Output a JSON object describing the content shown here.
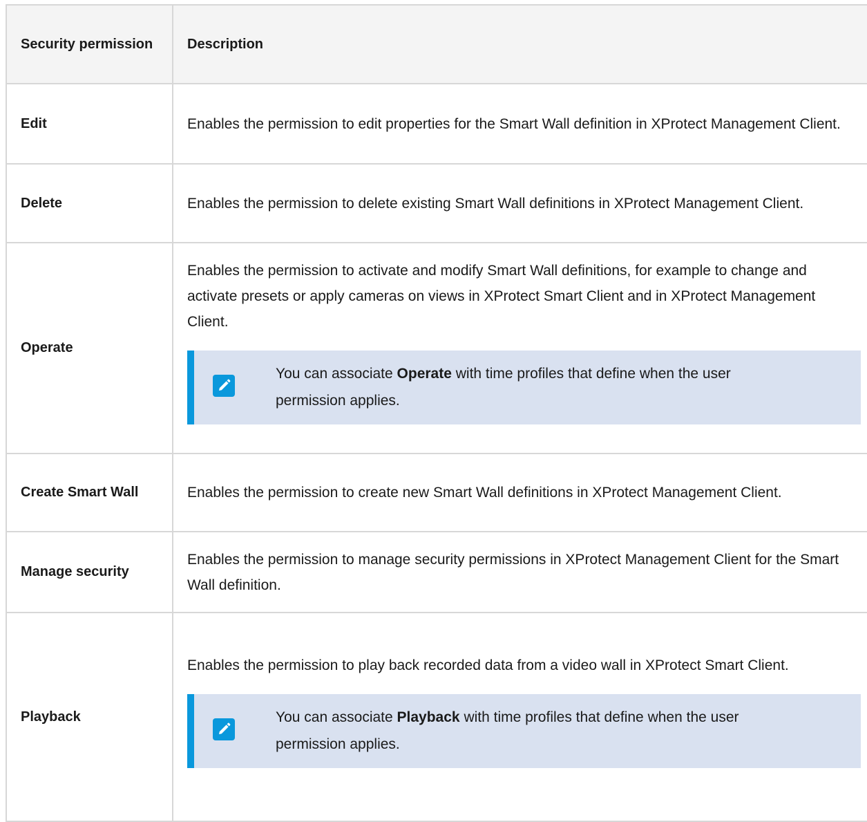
{
  "table": {
    "headers": {
      "permission": "Security permission",
      "description": "Description"
    },
    "rows": [
      {
        "name": "Edit",
        "description": "Enables the permission to edit properties for the Smart Wall definition in XProtect Management Client."
      },
      {
        "name": "Delete",
        "description": "Enables the permission to delete existing Smart Wall definitions in XProtect Management Client."
      },
      {
        "name": "Operate",
        "description": "Enables the permission to activate and modify Smart Wall definitions, for example to change and activate presets or apply cameras on views in XProtect Smart Client and in XProtect Management Client.",
        "note": {
          "prefix": "You can associate ",
          "bold": "Operate",
          "suffix": " with time profiles that define when the user permission applies.",
          "icon": "pencil-note-icon"
        }
      },
      {
        "name": "Create Smart Wall",
        "description": "Enables the permission to create new Smart Wall definitions in XProtect Management Client."
      },
      {
        "name": "Manage security",
        "description": "Enables the permission to manage security permissions in XProtect Management Client for the Smart Wall definition."
      },
      {
        "name": "Playback",
        "description": "Enables the permission to play back recorded data from a video wall in XProtect Smart Client.",
        "note": {
          "prefix": "You can associate ",
          "bold": "Playback",
          "suffix": " with time profiles that define when the user permission applies.",
          "icon": "pencil-note-icon"
        }
      }
    ]
  },
  "colors": {
    "note_background": "#d9e1f0",
    "note_accent": "#0a98dc",
    "header_background": "#f4f4f4",
    "border": "#d7d7d7"
  }
}
